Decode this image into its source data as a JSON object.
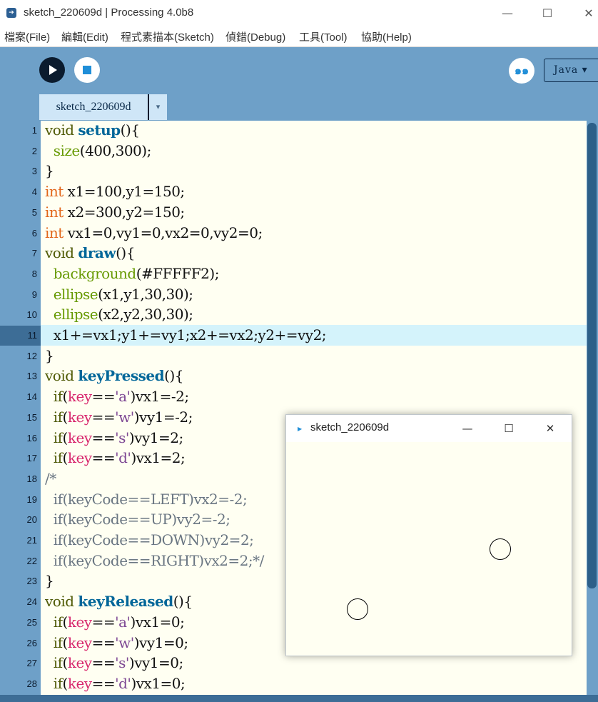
{
  "window": {
    "title": "sketch_220609d | Processing 4.0b8",
    "minimize": "—",
    "maximize": "☐",
    "close": "✕"
  },
  "menu": [
    "檔案(File)",
    "編輯(Edit)",
    "程式素描本(Sketch)",
    "偵錯(Debug)",
    "工具(Tool)",
    "協助(Help)"
  ],
  "toolbar": {
    "debug_glyph": "๑๑",
    "mode_label": "Java ▾"
  },
  "tab": {
    "name": "sketch_220609d",
    "menu_glyph": "▾"
  },
  "editor": {
    "current_line": 11,
    "lines": [
      "void setup(){",
      "  size(400,300);",
      "}",
      "int x1=100,y1=150;",
      "int x2=300,y2=150;",
      "int vx1=0,vy1=0,vx2=0,vy2=0;",
      "void draw(){",
      "  background(#FFFFF2);",
      "  ellipse(x1,y1,30,30);",
      "  ellipse(x2,y2,30,30);",
      "  x1+=vx1;y1+=vy1;x2+=vx2;y2+=vy2;",
      "}",
      "void keyPressed(){",
      "  if(key=='a')vx1=-2;",
      "  if(key=='w')vy1=-2;",
      "  if(key=='s')vy1=2;",
      "  if(key=='d')vx1=2;",
      "/*",
      "  if(keyCode==LEFT)vx2=-2;",
      "  if(keyCode==UP)vy2=-2;",
      "  if(keyCode==DOWN)vy2=2;",
      "  if(keyCode==RIGHT)vx2=2;*/",
      "}",
      "void keyReleased(){",
      "  if(key=='a')vx1=0;",
      "  if(key=='w')vy1=0;",
      "  if(key=='s')vy1=0;",
      "  if(key=='d')vx1=0;"
    ]
  },
  "sketch_window": {
    "title": "sketch_220609d",
    "background": "#FFFFF2",
    "minimize": "—",
    "maximize": "☐",
    "close": "✕"
  },
  "colors": {
    "ide_background": "#6ea0c8",
    "editor_background": "#fffff2",
    "current_line": "#d4f3fb",
    "run_button": "#0b1b2e",
    "stop_square": "#1f8ed8"
  }
}
